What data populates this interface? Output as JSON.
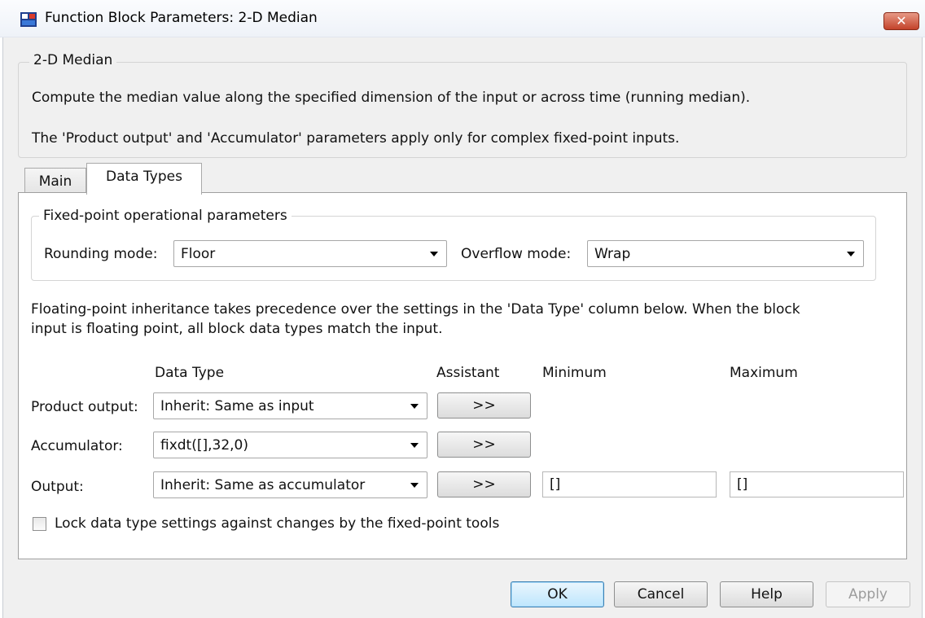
{
  "window": {
    "title": "Function Block Parameters: 2-D Median",
    "close_label": "✕"
  },
  "block": {
    "group_title": "2-D Median",
    "description_1": "Compute the median value along the specified dimension of the input or across time (running median).",
    "description_2": "The 'Product output' and 'Accumulator' parameters apply only for complex fixed-point inputs."
  },
  "tabs": [
    {
      "label": "Main",
      "active": false
    },
    {
      "label": "Data Types",
      "active": true
    }
  ],
  "fixed_point": {
    "group_title": "Fixed-point operational parameters",
    "rounding_label": "Rounding mode:",
    "rounding_value": "Floor",
    "overflow_label": "Overflow mode:",
    "overflow_value": "Wrap"
  },
  "inheritance_note_1": "Floating-point inheritance takes precedence over the settings in the 'Data Type' column below. When the block",
  "inheritance_note_2": "input is floating point, all block data types match the input.",
  "columns": {
    "data_type": "Data Type",
    "assistant": "Assistant",
    "minimum": "Minimum",
    "maximum": "Maximum"
  },
  "rows": [
    {
      "label": "Product output:",
      "data_type": "Inherit: Same as input",
      "assistant": ">>"
    },
    {
      "label": "Accumulator:",
      "data_type": "fixdt([],32,0)",
      "assistant": ">>"
    },
    {
      "label": "Output:",
      "data_type": "Inherit: Same as accumulator",
      "assistant": ">>",
      "minimum": "[]",
      "maximum": "[]"
    }
  ],
  "lock_label": "Lock data type settings against changes by the fixed-point tools",
  "buttons": {
    "ok": "OK",
    "cancel": "Cancel",
    "help": "Help",
    "apply": "Apply"
  }
}
